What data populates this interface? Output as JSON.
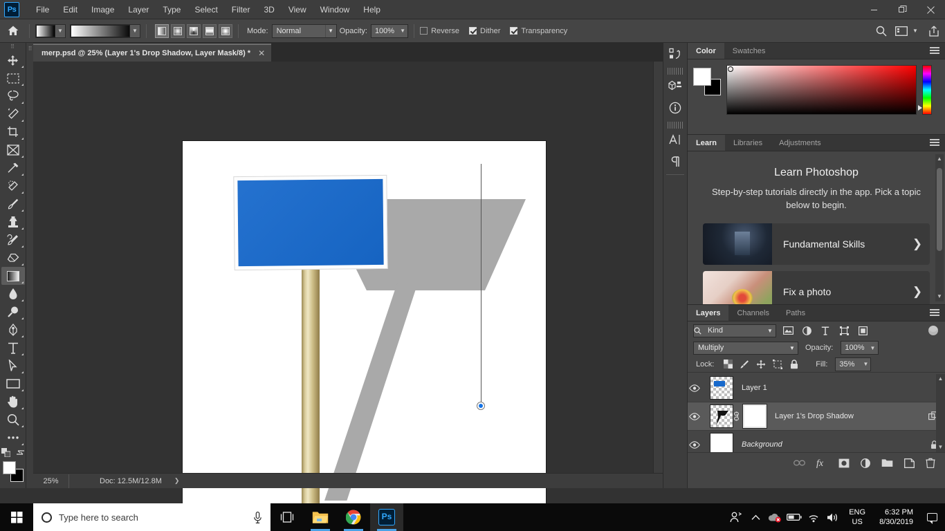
{
  "app": {
    "name": "Adobe Photoshop",
    "logo_text": "Ps"
  },
  "menubar": {
    "items": [
      "File",
      "Edit",
      "Image",
      "Layer",
      "Type",
      "Select",
      "Filter",
      "3D",
      "View",
      "Window",
      "Help"
    ],
    "window_controls": {
      "minimize": "—",
      "restore": "❐",
      "close": "✕"
    }
  },
  "options_bar": {
    "home_icon": "home-icon",
    "gradient_preset_label": "gradient-preset",
    "gradient_bar_label": "gradient-editor",
    "gradient_types": [
      "Linear Gradient",
      "Radial Gradient",
      "Angle Gradient",
      "Reflected Gradient",
      "Diamond Gradient"
    ],
    "active_gradient_type": "Linear Gradient",
    "mode_label": "Mode:",
    "mode_value": "Normal",
    "opacity_label": "Opacity:",
    "opacity_value": "100%",
    "checkboxes": [
      {
        "label": "Reverse",
        "checked": false
      },
      {
        "label": "Dither",
        "checked": true
      },
      {
        "label": "Transparency",
        "checked": true
      }
    ],
    "right_icons": [
      "search-icon",
      "workspace-icon",
      "chevron-down-icon",
      "share-icon"
    ]
  },
  "toolbar": {
    "tools": [
      {
        "name": "move-tool",
        "glyph": "move"
      },
      {
        "name": "marquee-tool",
        "glyph": "marquee"
      },
      {
        "name": "lasso-tool",
        "glyph": "lasso"
      },
      {
        "name": "quick-selection-tool",
        "glyph": "wand"
      },
      {
        "name": "crop-tool",
        "glyph": "crop"
      },
      {
        "name": "frame-tool",
        "glyph": "frame"
      },
      {
        "name": "eyedropper-tool",
        "glyph": "eyedropper"
      },
      {
        "name": "spot-healing-tool",
        "glyph": "healing"
      },
      {
        "name": "brush-tool",
        "glyph": "brush"
      },
      {
        "name": "clone-stamp-tool",
        "glyph": "stamp"
      },
      {
        "name": "history-brush-tool",
        "glyph": "historybrush"
      },
      {
        "name": "eraser-tool",
        "glyph": "eraser"
      },
      {
        "name": "gradient-tool",
        "glyph": "gradient",
        "selected": true
      },
      {
        "name": "blur-tool",
        "glyph": "blur"
      },
      {
        "name": "dodge-tool",
        "glyph": "dodge"
      },
      {
        "name": "pen-tool",
        "glyph": "pen"
      },
      {
        "name": "type-tool",
        "glyph": "type"
      },
      {
        "name": "path-selection-tool",
        "glyph": "arrow"
      },
      {
        "name": "rectangle-tool",
        "glyph": "rectangle"
      },
      {
        "name": "hand-tool",
        "glyph": "hand"
      },
      {
        "name": "zoom-tool",
        "glyph": "zoom"
      },
      {
        "name": "edit-toolbar-button",
        "glyph": "ellipsis"
      }
    ],
    "foreground_color": "#ffffff",
    "background_color": "#000000"
  },
  "document": {
    "tab_title": "merp.psd @ 25% (Layer 1's Drop Shadow, Layer Mask/8) *",
    "close_label": "✕",
    "status": {
      "zoom": "25%",
      "doc_label": "Doc: 12.5M/12.8M",
      "arrow": "❯"
    },
    "canvas": {
      "sign_color": "#1769cc",
      "sign_border_color": "#fdfdfd",
      "shadow_color": "#a9a9a9",
      "post_color": "#d8cb9a",
      "background_color": "#ffffff",
      "path_anchor_color": "#1473e6"
    }
  },
  "rail": {
    "items": [
      {
        "name": "history-icon",
        "glyph": "history"
      },
      {
        "name": "3d-icon",
        "glyph": "cube"
      },
      {
        "name": "info-icon",
        "glyph": "info"
      },
      {
        "name": "character-icon",
        "glyph": "A"
      },
      {
        "name": "paragraph-icon",
        "glyph": "¶"
      }
    ]
  },
  "color_panel": {
    "tabs": [
      {
        "label": "Color",
        "active": true
      },
      {
        "label": "Swatches",
        "active": false
      }
    ],
    "menu_icon": "panel-menu-icon",
    "foreground": "#ffffff",
    "background": "#000000",
    "hue_base": "#ff0000"
  },
  "learn_panel": {
    "tabs": [
      {
        "label": "Learn",
        "active": true
      },
      {
        "label": "Libraries",
        "active": false
      },
      {
        "label": "Adjustments",
        "active": false
      }
    ],
    "menu_icon": "panel-menu-icon",
    "title": "Learn Photoshop",
    "subtitle": "Step-by-step tutorials directly in the app. Pick a topic below to begin.",
    "cards": [
      {
        "title": "Fundamental Skills",
        "chevron": "❯"
      },
      {
        "title": "Fix a photo",
        "chevron": "❯"
      }
    ]
  },
  "layers_panel": {
    "tabs": [
      {
        "label": "Layers",
        "active": true
      },
      {
        "label": "Channels",
        "active": false
      },
      {
        "label": "Paths",
        "active": false
      }
    ],
    "menu_icon": "panel-menu-icon",
    "filter": {
      "kind_label": "Kind",
      "search_icon": "search-icon",
      "filter_icons": [
        "pixel-filter-icon",
        "adjustment-filter-icon",
        "type-filter-icon",
        "shape-filter-icon",
        "smart-object-filter-icon"
      ],
      "toggle_name": "filter-toggle-switch"
    },
    "blend_mode": "Multiply",
    "opacity_label": "Opacity:",
    "opacity_value": "100%",
    "lock_label": "Lock:",
    "lock_icons": [
      "lock-transparent-pixels-icon",
      "lock-image-pixels-icon",
      "lock-position-icon",
      "lock-artboard-nesting-icon",
      "lock-all-icon"
    ],
    "fill_label": "Fill:",
    "fill_value": "35%",
    "layers": [
      {
        "name": "Layer 1",
        "visible": true,
        "active": false,
        "italic": false,
        "has_mask": false,
        "thumb": "blue-sign",
        "right_icon": ""
      },
      {
        "name": "Layer 1's Drop Shadow",
        "visible": true,
        "active": true,
        "italic": false,
        "has_mask": true,
        "thumb": "black-shadow",
        "right_icon": "smart-object-badge"
      },
      {
        "name": "Background",
        "visible": true,
        "active": false,
        "italic": true,
        "has_mask": false,
        "thumb": "white",
        "right_icon": "lock-badge"
      }
    ],
    "footer_buttons": [
      "link-layers-icon",
      "add-layer-style-icon",
      "add-layer-mask-icon",
      "new-adjustment-layer-icon",
      "new-group-icon",
      "new-layer-icon",
      "delete-layer-icon"
    ]
  },
  "taskbar": {
    "start_label": "start-button",
    "search_placeholder": "Type here to search",
    "mic_icon": "microphone-icon",
    "items": [
      {
        "name": "task-view-button",
        "glyph": "taskview"
      },
      {
        "name": "file-explorer-button",
        "glyph": "folder"
      },
      {
        "name": "chrome-button",
        "glyph": "chrome"
      },
      {
        "name": "photoshop-button",
        "glyph": "ps",
        "active": true
      }
    ],
    "tray": {
      "people_icon": "people-icon",
      "chevron_icon": "show-hidden-icons-chevron",
      "onedrive_icon": "onedrive-error-icon",
      "battery_icon": "battery-icon",
      "wifi_icon": "wifi-icon",
      "volume_icon": "volume-icon",
      "language_line1": "ENG",
      "language_line2": "US",
      "time": "6:32 PM",
      "date": "8/30/2019",
      "notifications_icon": "notification-center-icon"
    }
  }
}
